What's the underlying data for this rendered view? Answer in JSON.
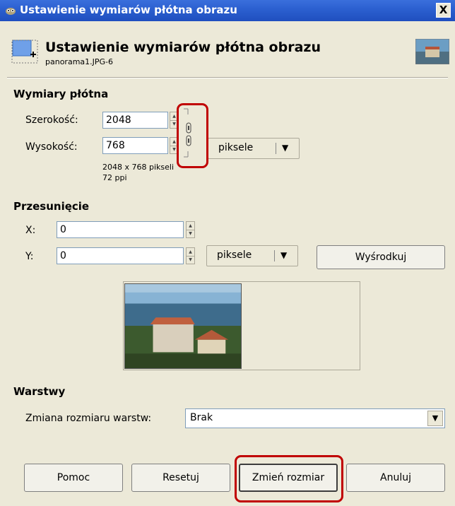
{
  "window": {
    "title": "Ustawienie wymiarów płótna obrazu",
    "close_glyph": "X"
  },
  "header": {
    "title": "Ustawienie wymiarów płótna obrazu",
    "subtitle": "panorama1.JPG-6"
  },
  "canvas_size": {
    "section_label": "Wymiary płótna",
    "width_label": "Szerokość:",
    "width_value": "2048",
    "height_label": "Wysokość:",
    "height_value": "768",
    "unit": "piksele",
    "info_size": "2048 x 768 pikseli",
    "info_ppi": "72 ppi"
  },
  "offset": {
    "section_label": "Przesunięcie",
    "x_label": "X:",
    "x_value": "0",
    "y_label": "Y:",
    "y_value": "0",
    "unit": "piksele",
    "center_button": "Wyśrodkuj"
  },
  "layers": {
    "section_label": "Warstwy",
    "resize_label": "Zmiana rozmiaru warstw:",
    "resize_value": "Brak"
  },
  "buttons": {
    "help": "Pomoc",
    "reset": "Resetuj",
    "resize": "Zmień rozmiar",
    "cancel": "Anuluj"
  },
  "colors": {
    "titlebar": "#2b5fcf",
    "dialog_bg": "#ece9d8",
    "highlight": "#c00000"
  },
  "icons": [
    "gimp-icon",
    "close-icon",
    "canvas-size-icon",
    "chain-link-icon",
    "dropdown-arrow-icon"
  ]
}
